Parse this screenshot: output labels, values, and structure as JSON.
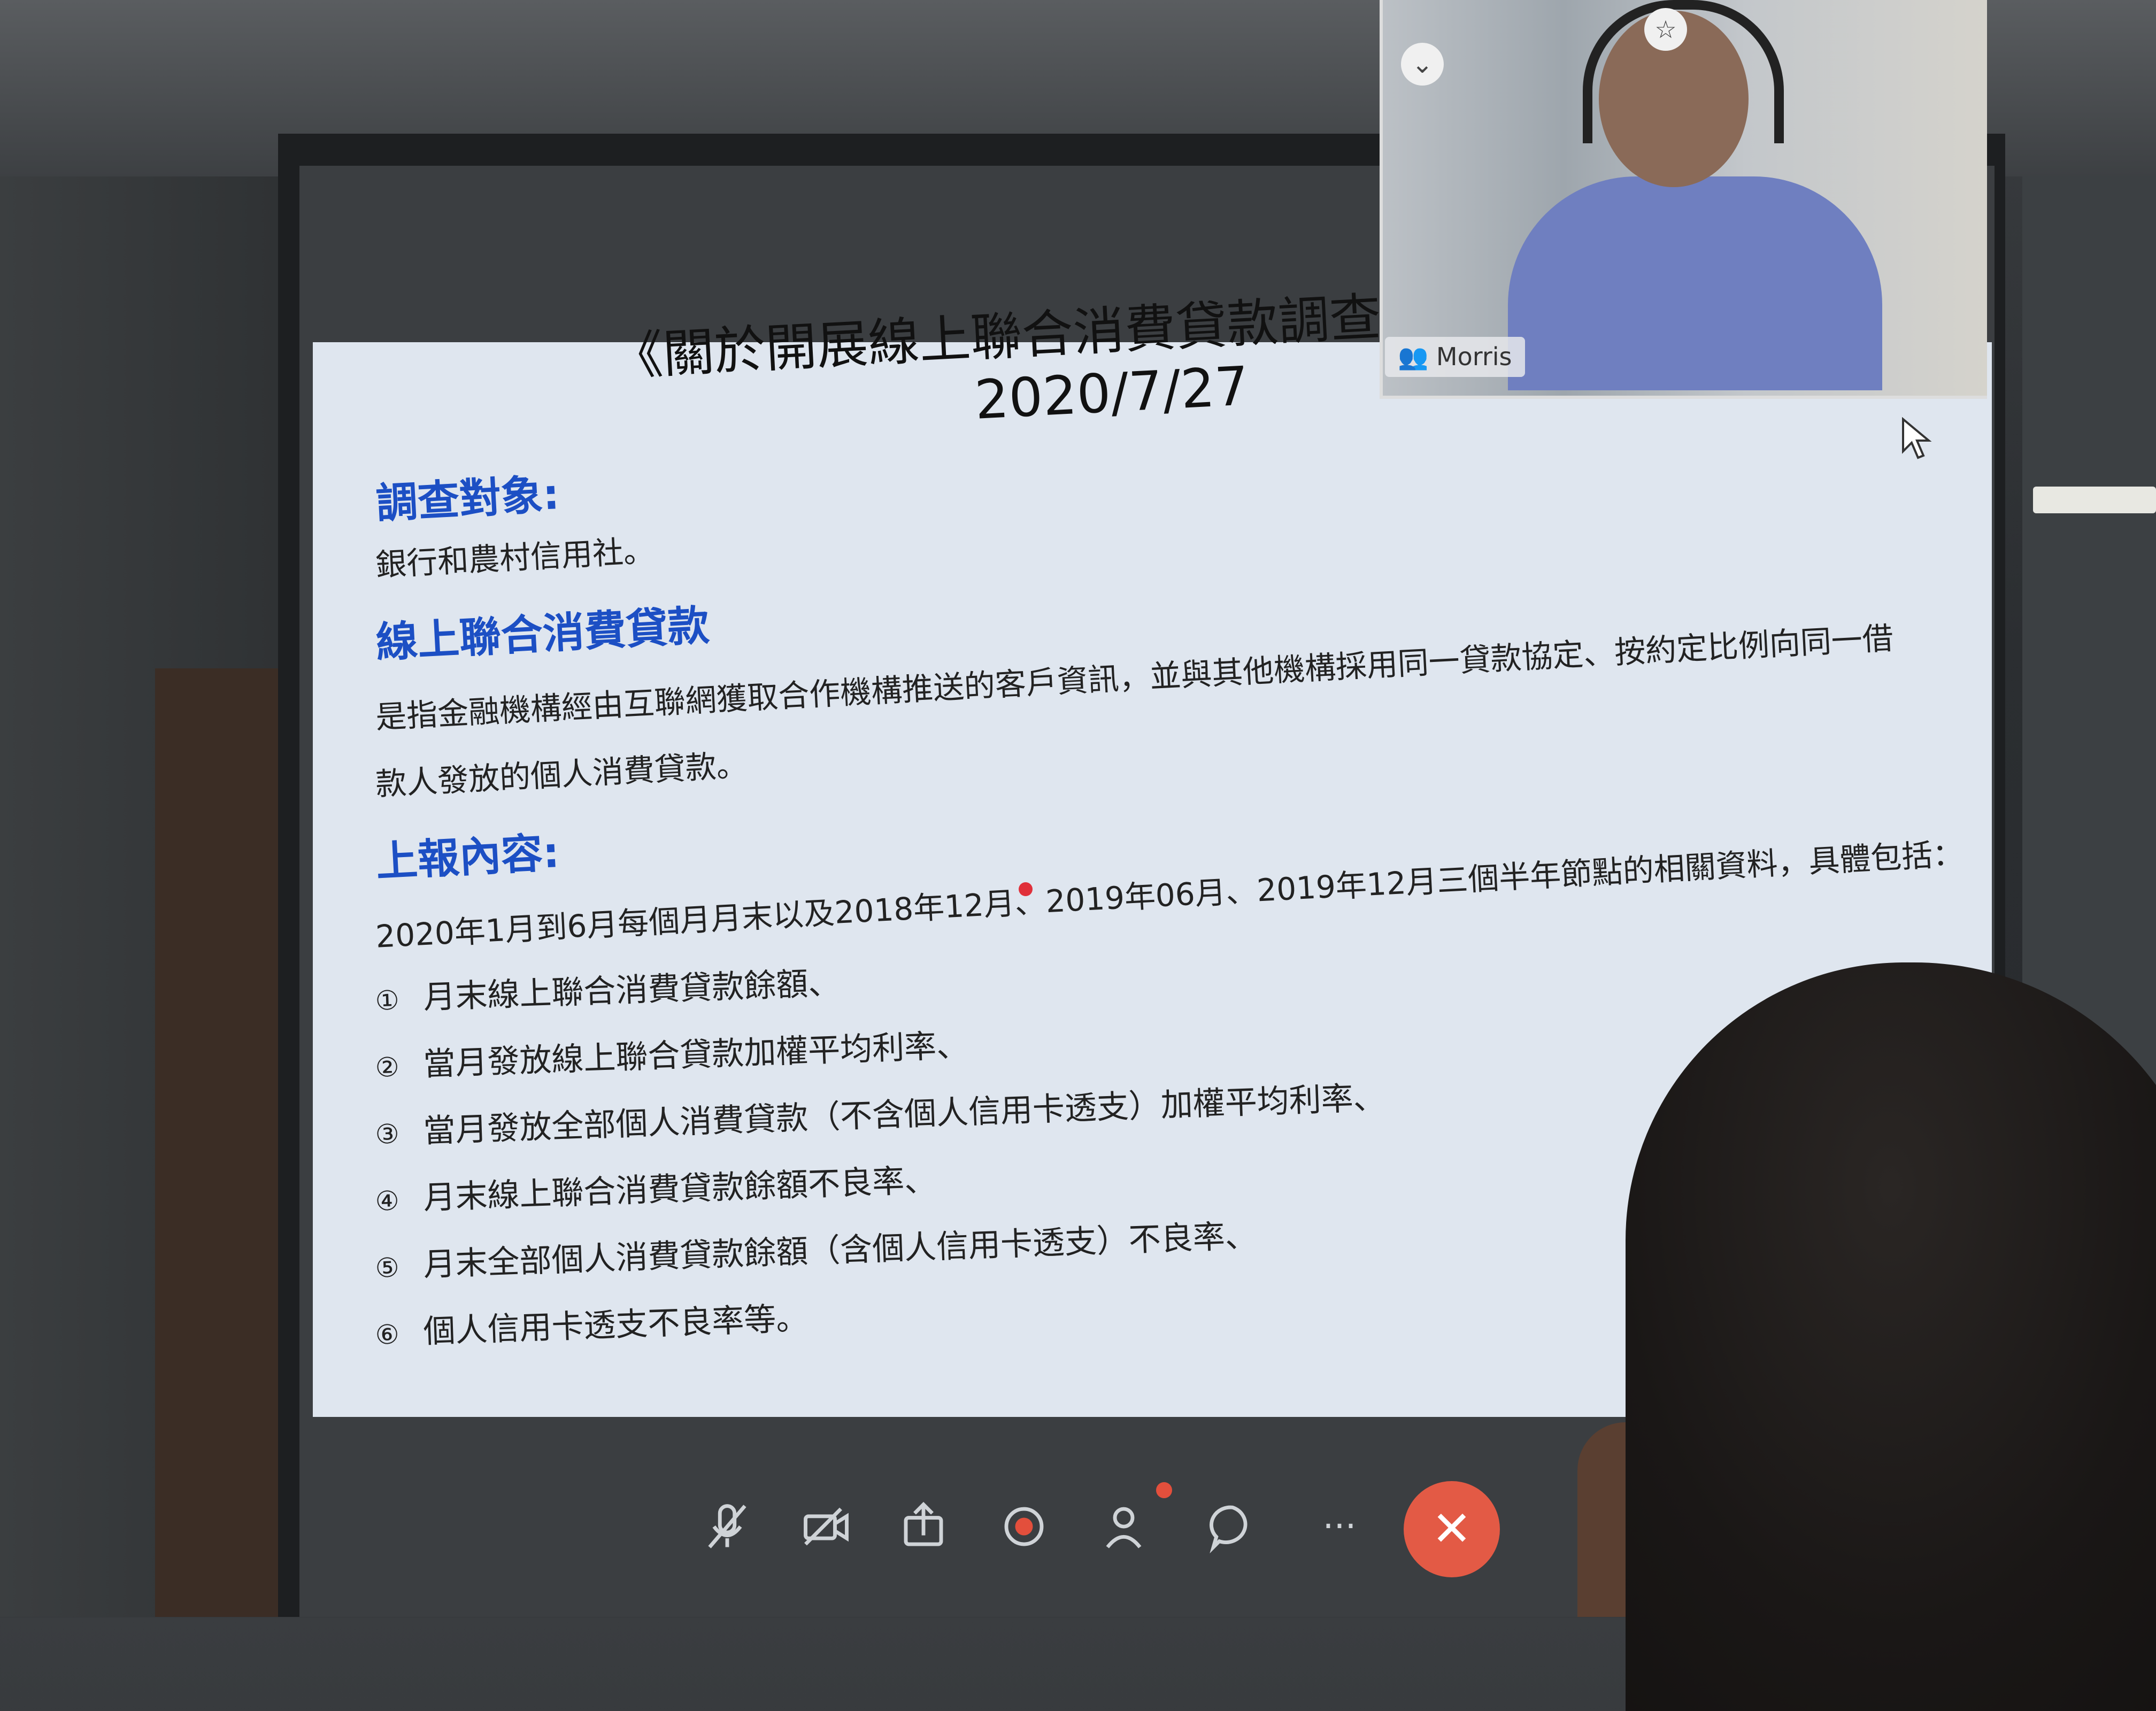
{
  "slide": {
    "title": "《關於開展線上聯合消費貸款調查的",
    "date": "2020/7/27",
    "sections": [
      {
        "heading": "調查對象:",
        "lines": [
          "銀行和農村信用社。"
        ]
      },
      {
        "heading": "線上聯合消費貸款",
        "lines": [
          "是指金融機構經由互聯網獲取合作機構推送的客戶資訊，並與其他機構採用同一貸款協定、按約定比例向同一借",
          "款人發放的個人消費貸款。"
        ]
      },
      {
        "heading": "上報內容:",
        "lines": [
          "2020年1月到6月每個月月末以及2018年12月、2019年06月、2019年12月三個半年節點的相關資料，具體包括："
        ]
      }
    ],
    "list": [
      {
        "num": "①",
        "text": "月末線上聯合消費貸款餘額、"
      },
      {
        "num": "②",
        "text": "當月發放線上聯合貸款加權平均利率、"
      },
      {
        "num": "③",
        "text": "當月發放全部個人消費貸款（不含個人信用卡透支）加權平均利率、"
      },
      {
        "num": "④",
        "text": "月末線上聯合消費貸款餘額不良率、"
      },
      {
        "num": "⑤",
        "text": "月末全部個人消費貸款餘額（含個人信用卡透支）不良率、"
      },
      {
        "num": "⑥",
        "text": "個人信用卡透支不良率等。"
      }
    ]
  },
  "video": {
    "participant_name": "Morris"
  },
  "toolbar": {
    "icons": [
      "mic-muted-icon",
      "camera-off-icon",
      "share-screen-icon",
      "record-icon",
      "participants-icon",
      "chat-icon",
      "more-icon",
      "end-call-icon"
    ],
    "end_color": "#e35a45"
  }
}
